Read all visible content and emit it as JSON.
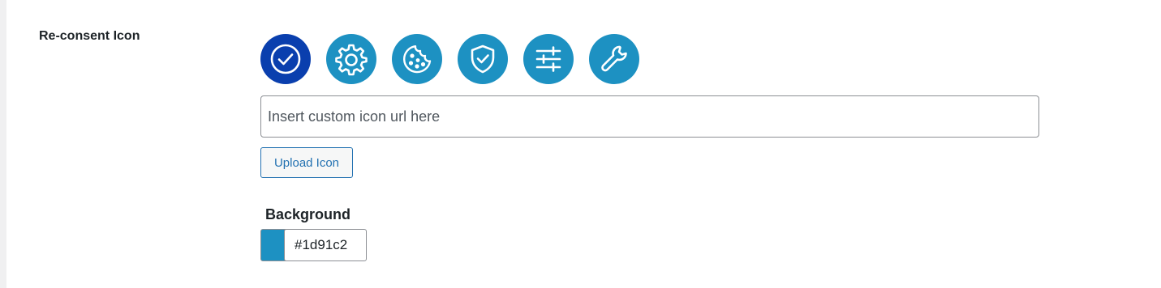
{
  "setting": {
    "label": "Re-consent Icon"
  },
  "icons": [
    {
      "name": "check-circle-icon",
      "selected": true
    },
    {
      "name": "gear-icon",
      "selected": false
    },
    {
      "name": "cookie-icon",
      "selected": false
    },
    {
      "name": "shield-check-icon",
      "selected": false
    },
    {
      "name": "sliders-icon",
      "selected": false
    },
    {
      "name": "wrench-icon",
      "selected": false
    }
  ],
  "custom_url": {
    "value": "",
    "placeholder": "Insert custom icon url here"
  },
  "upload": {
    "label": "Upload Icon"
  },
  "background": {
    "label": "Background",
    "color": "#1d91c2",
    "value": "#1d91c2"
  },
  "colors": {
    "icon_bg": "#1d91c2",
    "icon_selected_bg": "#0a3fae"
  }
}
